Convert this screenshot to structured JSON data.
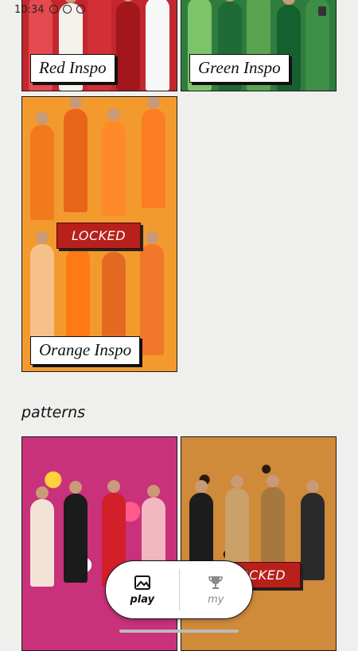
{
  "status_bar": {
    "time": "10:34"
  },
  "cards": [
    {
      "id": "red",
      "label": "Red Inspo",
      "locked": false,
      "bg": "#c2272d"
    },
    {
      "id": "green",
      "label": "Green Inspo",
      "locked": false,
      "bg": "#2f7d3e"
    },
    {
      "id": "orange",
      "label": "Orange Inspo",
      "locked": true,
      "locked_label": "LOCKED",
      "bg": "#f39a2e"
    }
  ],
  "patterns": {
    "title": "patterns",
    "cards": [
      {
        "id": "floral",
        "locked": false,
        "bg": "#c9317a"
      },
      {
        "id": "leopard",
        "locked": true,
        "locked_label": "LOCKED",
        "bg": "#b5722b"
      }
    ]
  },
  "bottom_nav": {
    "items": [
      {
        "label": "play",
        "icon": "image-icon",
        "active": true
      },
      {
        "label": "my",
        "icon": "trophy-icon",
        "active": false
      }
    ]
  },
  "colors": {
    "background": "#efefed",
    "locked_badge": "#b8201b",
    "border": "#1b1b1b"
  }
}
